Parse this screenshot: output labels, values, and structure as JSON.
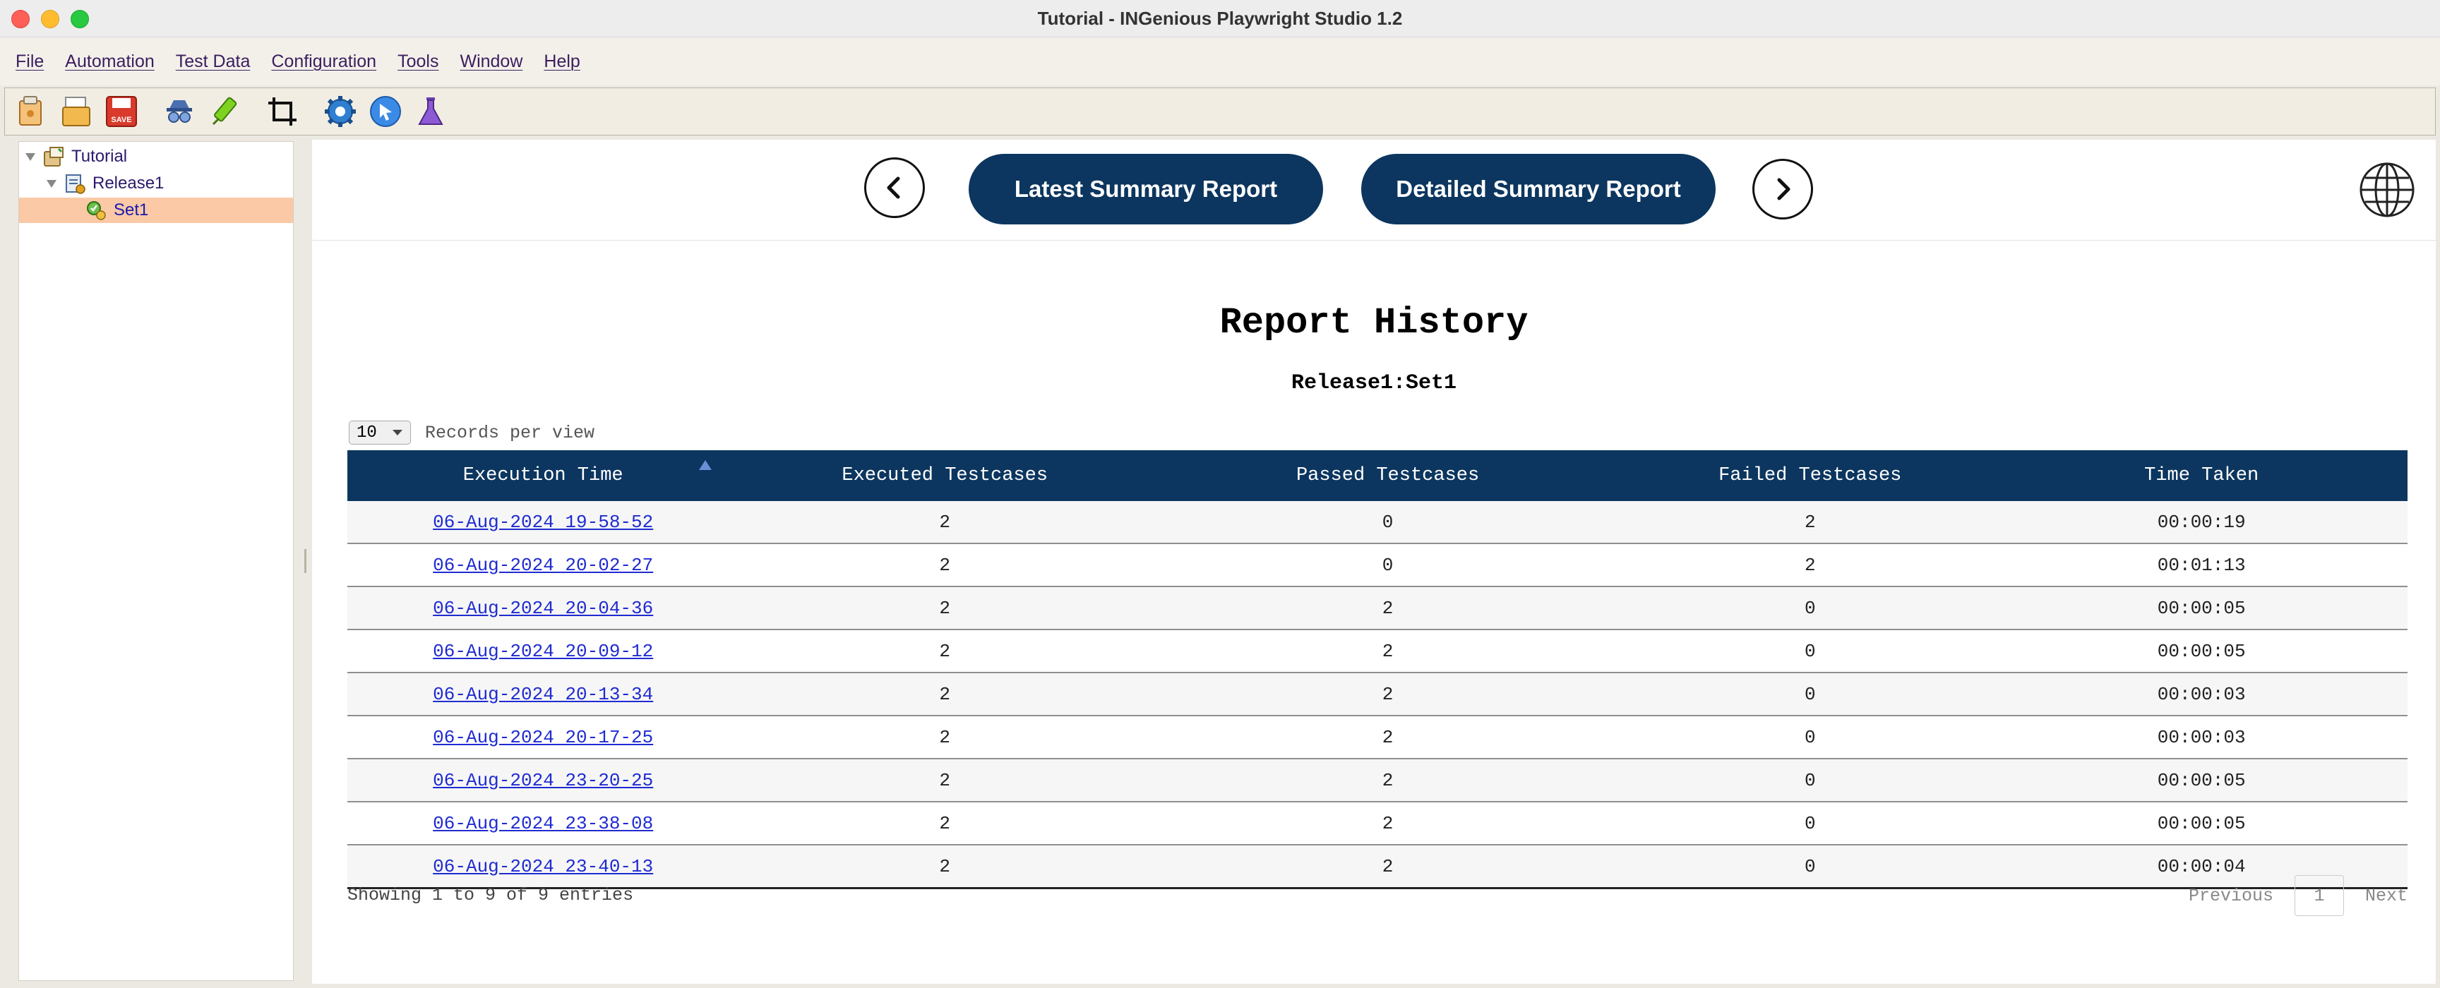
{
  "window": {
    "title": "Tutorial - INGenious Playwright Studio 1.2"
  },
  "menu": [
    "File",
    "Automation",
    "Test Data",
    "Configuration",
    "Tools",
    "Window",
    "Help"
  ],
  "toolbar": {
    "icons": [
      "open-project-icon",
      "open-folder-icon",
      "save-icon",
      "spy-icon",
      "highlight-icon",
      "crop-icon",
      "settings-gear-icon",
      "pointer-icon",
      "flask-icon"
    ],
    "save_text": "SAVE"
  },
  "tree": {
    "root": "Tutorial",
    "release": "Release1",
    "set": "Set1"
  },
  "nav": {
    "latest_label": "Latest Summary Report",
    "detailed_label": "Detailed Summary Report",
    "accent": "#0c365f"
  },
  "report": {
    "title": "Report History",
    "subtitle": "Release1:Set1",
    "records_value": "10",
    "records_label": "Records per view",
    "columns": [
      "Execution Time",
      "Executed Testcases",
      "Passed Testcases",
      "Failed Testcases",
      "Time Taken"
    ],
    "rows": [
      {
        "time": "06-Aug-2024 19-58-52",
        "executed": "2",
        "passed": "0",
        "failed": "2",
        "taken": "00:00:19"
      },
      {
        "time": "06-Aug-2024 20-02-27",
        "executed": "2",
        "passed": "0",
        "failed": "2",
        "taken": "00:01:13"
      },
      {
        "time": "06-Aug-2024 20-04-36",
        "executed": "2",
        "passed": "2",
        "failed": "0",
        "taken": "00:00:05"
      },
      {
        "time": "06-Aug-2024 20-09-12",
        "executed": "2",
        "passed": "2",
        "failed": "0",
        "taken": "00:00:05"
      },
      {
        "time": "06-Aug-2024 20-13-34",
        "executed": "2",
        "passed": "2",
        "failed": "0",
        "taken": "00:00:03"
      },
      {
        "time": "06-Aug-2024 20-17-25",
        "executed": "2",
        "passed": "2",
        "failed": "0",
        "taken": "00:00:03"
      },
      {
        "time": "06-Aug-2024 23-20-25",
        "executed": "2",
        "passed": "2",
        "failed": "0",
        "taken": "00:00:05"
      },
      {
        "time": "06-Aug-2024 23-38-08",
        "executed": "2",
        "passed": "2",
        "failed": "0",
        "taken": "00:00:05"
      },
      {
        "time": "06-Aug-2024 23-40-13",
        "executed": "2",
        "passed": "2",
        "failed": "0",
        "taken": "00:00:04"
      }
    ],
    "showing": "Showing 1 to 9 of 9 entries",
    "pager": {
      "previous": "Previous",
      "page": "1",
      "next": "Next"
    }
  }
}
